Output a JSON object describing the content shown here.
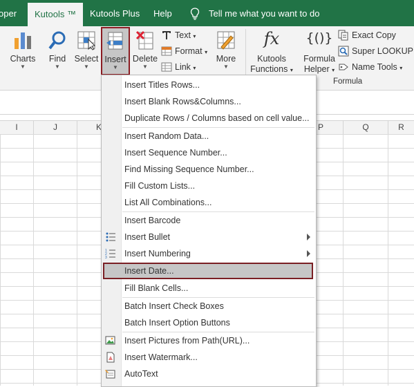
{
  "tabs": [
    {
      "label": "oper",
      "active": false
    },
    {
      "label": "Kutools ™",
      "active": true
    },
    {
      "label": "Kutools Plus",
      "active": false
    },
    {
      "label": "Help",
      "active": false
    }
  ],
  "tell_me": "Tell me what you want to do",
  "ribbon": {
    "charts": "Charts",
    "find": "Find",
    "select": "Select",
    "insert": "Insert",
    "delete": "Delete",
    "text": "Text",
    "format": "Format",
    "link": "Link",
    "more": "More",
    "kutools_functions_1": "Kutools",
    "kutools_functions_2": "Functions",
    "formula_helper_1": "Formula",
    "formula_helper_2": "Helper",
    "exact_copy": "Exact Copy",
    "super_lookup": "Super LOOKUP",
    "name_tools": "Name Tools",
    "group_formula": "Formula",
    "fx": "fx",
    "braces": "{()}"
  },
  "columns": [
    "I",
    "J",
    "K",
    "P",
    "Q",
    "R"
  ],
  "menu": {
    "items": [
      {
        "label": "Insert Titles Rows...",
        "icon": ""
      },
      {
        "label": "Insert Blank Rows&Columns...",
        "icon": ""
      },
      {
        "label": "Duplicate Rows / Columns based on cell value...",
        "icon": ""
      },
      {
        "label": "Insert Random Data...",
        "icon": ""
      },
      {
        "label": "Insert Sequence Number...",
        "icon": ""
      },
      {
        "label": "Find Missing Sequence Number...",
        "icon": ""
      },
      {
        "label": "Fill Custom Lists...",
        "icon": ""
      },
      {
        "label": "List All Combinations...",
        "icon": ""
      },
      {
        "label": "Insert Barcode",
        "icon": ""
      },
      {
        "label": "Insert Bullet",
        "icon": "bullet-list-icon"
      },
      {
        "label": "Insert Numbering",
        "icon": "numbered-list-icon"
      },
      {
        "label": "Insert Date...",
        "icon": "",
        "highlighted": true
      },
      {
        "label": "Fill Blank Cells...",
        "icon": ""
      },
      {
        "label": "Batch Insert Check Boxes",
        "icon": ""
      },
      {
        "label": "Batch Insert Option Buttons",
        "icon": ""
      },
      {
        "label": "Insert Pictures from Path(URL)...",
        "icon": "picture-path-icon"
      },
      {
        "label": "Insert Watermark...",
        "icon": "watermark-icon"
      },
      {
        "label": "AutoText",
        "icon": "autotext-icon"
      }
    ]
  },
  "colors": {
    "accent_green": "#217346",
    "highlight_border": "#7a1f24",
    "highlight_bg": "#c6c6c6"
  }
}
